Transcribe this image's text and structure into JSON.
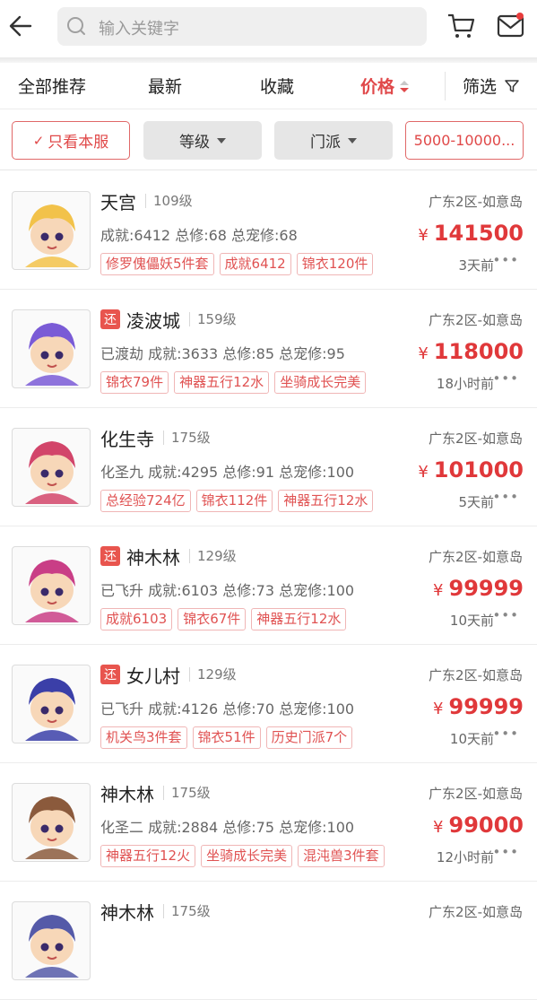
{
  "search": {
    "placeholder": "输入关键字"
  },
  "tabs": [
    {
      "label": "全部推荐"
    },
    {
      "label": "最新"
    },
    {
      "label": "收藏"
    },
    {
      "label": "价格"
    },
    {
      "label": "筛选"
    }
  ],
  "filters": {
    "only_server": "只看本服",
    "level": "等级",
    "school": "门派",
    "price_range": "5000-10000..."
  },
  "items": [
    {
      "avatar_hue": "#f2c24a",
      "returned": false,
      "name": "天宫",
      "level": "109级",
      "region": "广东2区-如意岛",
      "stats": "成就:6412 总修:68 总宠修:68",
      "currency": "¥",
      "price": "141500",
      "tags": [
        "修罗傀儡妖5件套",
        "成就6412",
        "锦衣120件"
      ],
      "time": "3天前"
    },
    {
      "avatar_hue": "#7a5bd6",
      "returned": true,
      "name": "凌波城",
      "level": "159级",
      "region": "广东2区-如意岛",
      "stats": "已渡劫 成就:3633 总修:85 总宠修:95",
      "currency": "¥",
      "price": "118000",
      "tags": [
        "锦衣79件",
        "神器五行12水",
        "坐骑成长完美"
      ],
      "time": "18小时前"
    },
    {
      "avatar_hue": "#d2456a",
      "returned": false,
      "name": "化生寺",
      "level": "175级",
      "region": "广东2区-如意岛",
      "stats": "化圣九 成就:4295 总修:91 总宠修:100",
      "currency": "¥",
      "price": "101000",
      "tags": [
        "总经验724亿",
        "锦衣112件",
        "神器五行12水"
      ],
      "time": "5天前"
    },
    {
      "avatar_hue": "#c93e86",
      "returned": true,
      "name": "神木林",
      "level": "129级",
      "region": "广东2区-如意岛",
      "stats": "已飞升 成就:6103 总修:73 总宠修:100",
      "currency": "¥",
      "price": "99999",
      "tags": [
        "成就6103",
        "锦衣67件",
        "神器五行12水"
      ],
      "time": "10天前"
    },
    {
      "avatar_hue": "#3b3fa8",
      "returned": true,
      "name": "女儿村",
      "level": "129级",
      "region": "广东2区-如意岛",
      "stats": "已飞升 成就:4126 总修:70 总宠修:100",
      "currency": "¥",
      "price": "99999",
      "tags": [
        "机关鸟3件套",
        "锦衣51件",
        "历史门派7个"
      ],
      "time": "10天前"
    },
    {
      "avatar_hue": "#8b5a3c",
      "returned": false,
      "name": "神木林",
      "level": "175级",
      "region": "广东2区-如意岛",
      "stats": "化圣二 成就:2884 总修:75 总宠修:100",
      "currency": "¥",
      "price": "99000",
      "tags": [
        "神器五行12火",
        "坐骑成长完美",
        "混沌兽3件套"
      ],
      "time": "12小时前"
    },
    {
      "avatar_hue": "#555aa8",
      "returned": false,
      "name": "神木林",
      "level": "175级",
      "region": "广东2区-如意岛",
      "stats": "",
      "currency": "",
      "price": "",
      "tags": [],
      "time": ""
    }
  ]
}
